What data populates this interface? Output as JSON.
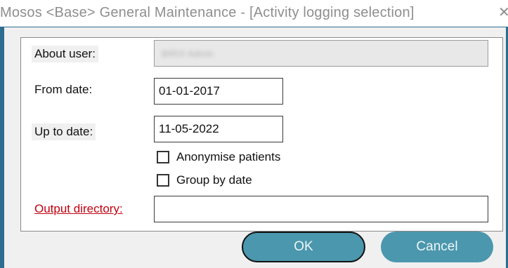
{
  "window": {
    "title": "Mosos <Base> General Maintenance - [Activity logging selection]",
    "close_glyph": "✕"
  },
  "form": {
    "about_user_label": "About user:",
    "about_user_value": "BIRIX Admin",
    "from_date_label": "From date:",
    "from_date_value": "01-01-2017",
    "up_to_date_label": "Up to date:",
    "up_to_date_value": "11-05-2022",
    "anonymise_label": "Anonymise patients",
    "anonymise_checked": false,
    "group_by_date_label": "Group by date",
    "group_by_date_checked": false,
    "output_directory_label": "Output directory:",
    "output_directory_value": ""
  },
  "buttons": {
    "ok_label": "OK",
    "cancel_label": "Cancel"
  },
  "colors": {
    "accent": "#2d6d8f",
    "button": "#4b97ad",
    "link": "#c0000f"
  }
}
